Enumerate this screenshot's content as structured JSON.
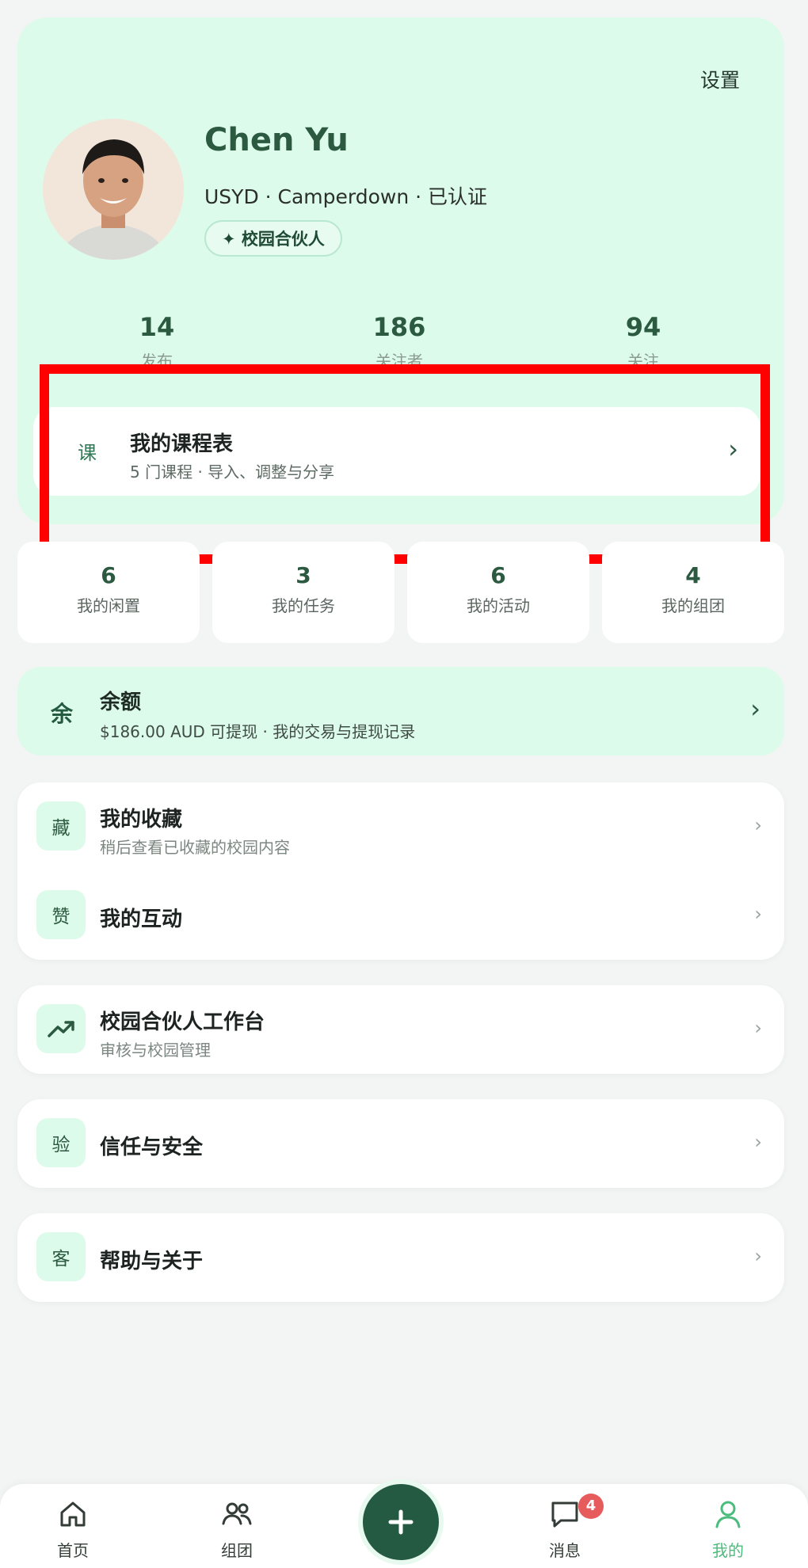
{
  "header": {
    "settings_label": "设置",
    "name": "Chen Yu",
    "subtitle": "USYD · Camperdown · 已认证",
    "badge": "✦ 校园合伙人"
  },
  "stats": [
    {
      "value": "14",
      "label": "发布"
    },
    {
      "value": "186",
      "label": "关注者"
    },
    {
      "value": "94",
      "label": "关注"
    }
  ],
  "course": {
    "tag": "课",
    "title": "我的课程表",
    "desc": "5 门课程 · 导入、调整与分享",
    "chevron": "›"
  },
  "tiles": [
    {
      "value": "6",
      "label": "我的闲置"
    },
    {
      "value": "3",
      "label": "我的任务"
    },
    {
      "value": "6",
      "label": "我的活动"
    },
    {
      "value": "4",
      "label": "我的组团"
    }
  ],
  "balance": {
    "icon_text": "余",
    "title": "余额",
    "desc": "$186.00 AUD 可提现 · 我的交易与提现记录",
    "chevron": "›"
  },
  "lists": {
    "favorites": {
      "icon_text": "藏",
      "title": "我的收藏",
      "desc": "稍后查看已收藏的校园内容"
    },
    "interactions": {
      "icon_text": "赞",
      "title": "我的互动"
    },
    "partner": {
      "icon": "trend-up-icon",
      "title": "校园合伙人工作台",
      "desc": "审核与校园管理"
    },
    "trust": {
      "icon_text": "验",
      "title": "信任与安全"
    },
    "help": {
      "icon_text": "客",
      "title": "帮助与关于"
    }
  },
  "nav": {
    "items": [
      {
        "label": "首页",
        "icon": "home-icon"
      },
      {
        "label": "组团",
        "icon": "group-icon"
      },
      {
        "label": "消息",
        "icon": "chat-icon"
      },
      {
        "label": "我的",
        "icon": "profile-icon"
      }
    ],
    "messages_badge": "4",
    "add_icon": "plus-icon"
  },
  "colors": {
    "accent": "#2b5a41",
    "mint": "#dcfbea",
    "active_nav": "#4cbc7c",
    "badge_red": "#e65b5b",
    "highlight": "#ff0000"
  }
}
